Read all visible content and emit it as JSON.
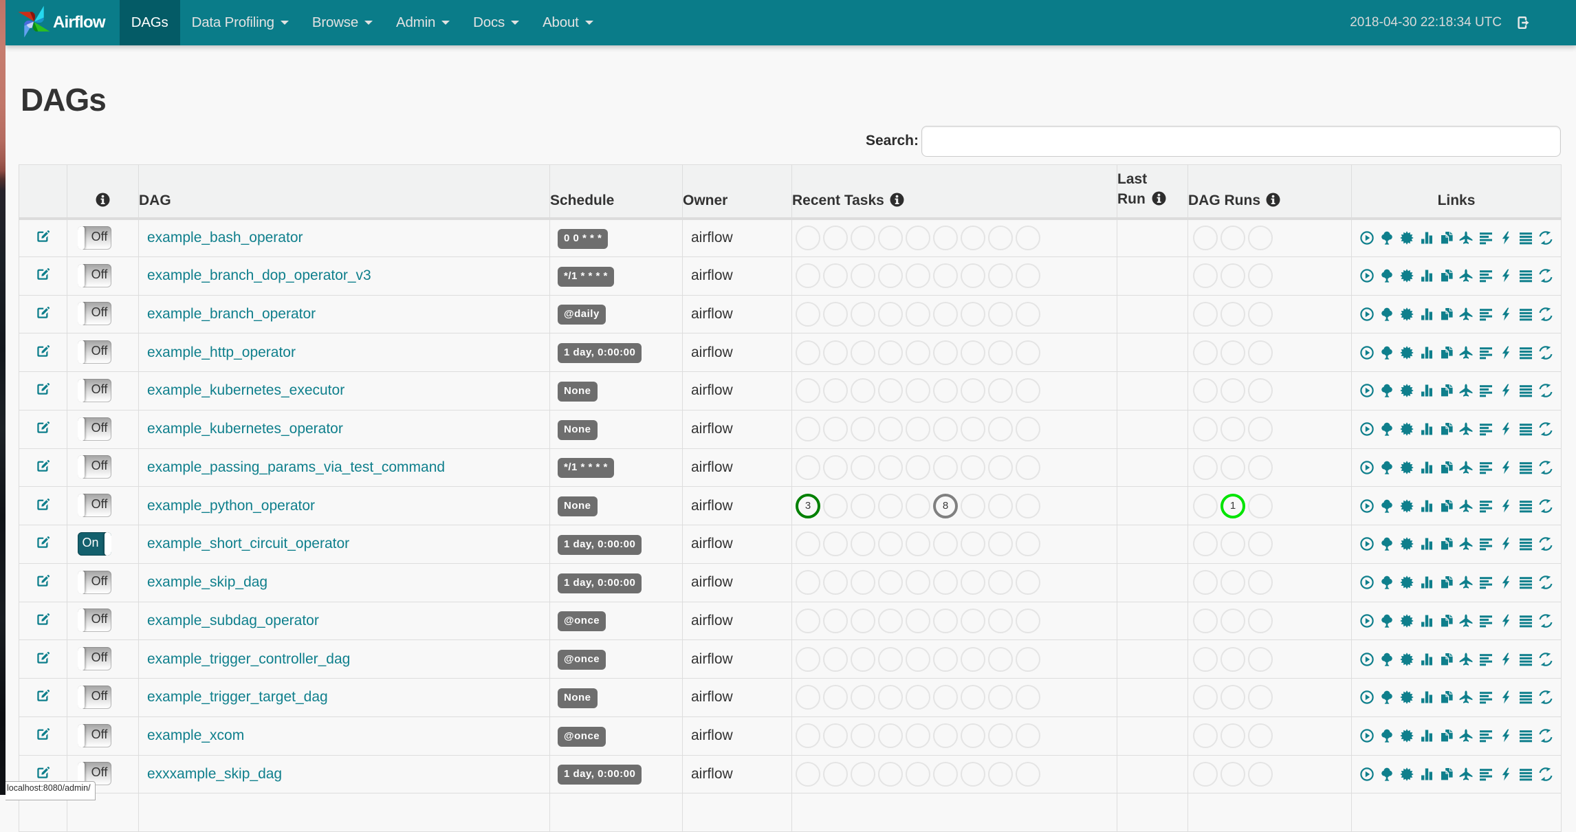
{
  "navbar": {
    "brand": "Airflow",
    "items": [
      {
        "label": "DAGs",
        "active": true,
        "dropdown": false
      },
      {
        "label": "Data Profiling",
        "active": false,
        "dropdown": true
      },
      {
        "label": "Browse",
        "active": false,
        "dropdown": true
      },
      {
        "label": "Admin",
        "active": false,
        "dropdown": true
      },
      {
        "label": "Docs",
        "active": false,
        "dropdown": true
      },
      {
        "label": "About",
        "active": false,
        "dropdown": true
      }
    ],
    "clock": "2018-04-30 22:18:34 UTC",
    "logout_icon": "log-out-icon"
  },
  "page": {
    "title": "DAGs"
  },
  "search": {
    "label": "Search:",
    "value": ""
  },
  "theme": {
    "navbar_bg": "#0a7c89",
    "navbar_active_bg": "#045b66",
    "link_color": "#0f7f8c",
    "badge_bg": "#6e6e6e",
    "border_color": "#dddddd",
    "success_color": "#008000",
    "queued_color": "#808080",
    "running_color": "#00e400",
    "empty_circle_color": "#e4e4e4"
  },
  "table": {
    "headers": {
      "edit": "",
      "info": "info-icon",
      "dag": "DAG",
      "schedule": "Schedule",
      "owner": "Owner",
      "recent_tasks": "Recent Tasks",
      "last_run": "Last Run",
      "dag_runs": "DAG Runs",
      "links": "Links"
    },
    "links": [
      {
        "name": "trigger-dag",
        "icon": "play-circle"
      },
      {
        "name": "tree-view",
        "icon": "tree"
      },
      {
        "name": "graph-view",
        "icon": "starburst"
      },
      {
        "name": "task-duration",
        "icon": "bar-chart"
      },
      {
        "name": "task-tries",
        "icon": "duplicate"
      },
      {
        "name": "landing-times",
        "icon": "plane"
      },
      {
        "name": "gantt-view",
        "icon": "align-left"
      },
      {
        "name": "code-view",
        "icon": "bolt"
      },
      {
        "name": "dag-details",
        "icon": "align-justify"
      },
      {
        "name": "refresh",
        "icon": "refresh"
      }
    ],
    "rows": [
      {
        "dag_id": "example_bash_operator",
        "toggle": "Off",
        "schedule": "0 0 * * *",
        "owner": "airflow",
        "recent_tasks": [
          null,
          null,
          null,
          null,
          null,
          null,
          null,
          null,
          null
        ],
        "last_run": "",
        "dag_runs": [
          null,
          null,
          null
        ]
      },
      {
        "dag_id": "example_branch_dop_operator_v3",
        "toggle": "Off",
        "schedule": "*/1 * * * *",
        "owner": "airflow",
        "recent_tasks": [
          null,
          null,
          null,
          null,
          null,
          null,
          null,
          null,
          null
        ],
        "last_run": "",
        "dag_runs": [
          null,
          null,
          null
        ]
      },
      {
        "dag_id": "example_branch_operator",
        "toggle": "Off",
        "schedule": "@daily",
        "owner": "airflow",
        "recent_tasks": [
          null,
          null,
          null,
          null,
          null,
          null,
          null,
          null,
          null
        ],
        "last_run": "",
        "dag_runs": [
          null,
          null,
          null
        ]
      },
      {
        "dag_id": "example_http_operator",
        "toggle": "Off",
        "schedule": "1 day, 0:00:00",
        "owner": "airflow",
        "recent_tasks": [
          null,
          null,
          null,
          null,
          null,
          null,
          null,
          null,
          null
        ],
        "last_run": "",
        "dag_runs": [
          null,
          null,
          null
        ]
      },
      {
        "dag_id": "example_kubernetes_executor",
        "toggle": "Off",
        "schedule": "None",
        "owner": "airflow",
        "recent_tasks": [
          null,
          null,
          null,
          null,
          null,
          null,
          null,
          null,
          null
        ],
        "last_run": "",
        "dag_runs": [
          null,
          null,
          null
        ]
      },
      {
        "dag_id": "example_kubernetes_operator",
        "toggle": "Off",
        "schedule": "None",
        "owner": "airflow",
        "recent_tasks": [
          null,
          null,
          null,
          null,
          null,
          null,
          null,
          null,
          null
        ],
        "last_run": "",
        "dag_runs": [
          null,
          null,
          null
        ]
      },
      {
        "dag_id": "example_passing_params_via_test_command",
        "toggle": "Off",
        "schedule": "*/1 * * * *",
        "owner": "airflow",
        "recent_tasks": [
          null,
          null,
          null,
          null,
          null,
          null,
          null,
          null,
          null
        ],
        "last_run": "",
        "dag_runs": [
          null,
          null,
          null
        ]
      },
      {
        "dag_id": "example_python_operator",
        "toggle": "Off",
        "schedule": "None",
        "owner": "airflow",
        "recent_tasks": [
          {
            "count": "3",
            "color": "#008000"
          },
          null,
          null,
          null,
          null,
          {
            "count": "8",
            "color": "#808080"
          },
          null,
          null,
          null
        ],
        "last_run": "",
        "dag_runs": [
          null,
          {
            "count": "1",
            "color": "#00e400"
          },
          null
        ]
      },
      {
        "dag_id": "example_short_circuit_operator",
        "toggle": "On",
        "schedule": "1 day, 0:00:00",
        "owner": "airflow",
        "recent_tasks": [
          null,
          null,
          null,
          null,
          null,
          null,
          null,
          null,
          null
        ],
        "last_run": "",
        "dag_runs": [
          null,
          null,
          null
        ]
      },
      {
        "dag_id": "example_skip_dag",
        "toggle": "Off",
        "schedule": "1 day, 0:00:00",
        "owner": "airflow",
        "recent_tasks": [
          null,
          null,
          null,
          null,
          null,
          null,
          null,
          null,
          null
        ],
        "last_run": "",
        "dag_runs": [
          null,
          null,
          null
        ]
      },
      {
        "dag_id": "example_subdag_operator",
        "toggle": "Off",
        "schedule": "@once",
        "owner": "airflow",
        "recent_tasks": [
          null,
          null,
          null,
          null,
          null,
          null,
          null,
          null,
          null
        ],
        "last_run": "",
        "dag_runs": [
          null,
          null,
          null
        ]
      },
      {
        "dag_id": "example_trigger_controller_dag",
        "toggle": "Off",
        "schedule": "@once",
        "owner": "airflow",
        "recent_tasks": [
          null,
          null,
          null,
          null,
          null,
          null,
          null,
          null,
          null
        ],
        "last_run": "",
        "dag_runs": [
          null,
          null,
          null
        ]
      },
      {
        "dag_id": "example_trigger_target_dag",
        "toggle": "Off",
        "schedule": "None",
        "owner": "airflow",
        "recent_tasks": [
          null,
          null,
          null,
          null,
          null,
          null,
          null,
          null,
          null
        ],
        "last_run": "",
        "dag_runs": [
          null,
          null,
          null
        ]
      },
      {
        "dag_id": "example_xcom",
        "toggle": "Off",
        "schedule": "@once",
        "owner": "airflow",
        "recent_tasks": [
          null,
          null,
          null,
          null,
          null,
          null,
          null,
          null,
          null
        ],
        "last_run": "",
        "dag_runs": [
          null,
          null,
          null
        ]
      },
      {
        "dag_id": "exxxample_skip_dag",
        "toggle": "Off",
        "schedule": "1 day, 0:00:00",
        "owner": "airflow",
        "recent_tasks": [
          null,
          null,
          null,
          null,
          null,
          null,
          null,
          null,
          null
        ],
        "last_run": "",
        "dag_runs": [
          null,
          null,
          null
        ]
      }
    ],
    "partial_row_visible": true
  },
  "status_bar": {
    "text": "localhost:8080/admin/"
  }
}
